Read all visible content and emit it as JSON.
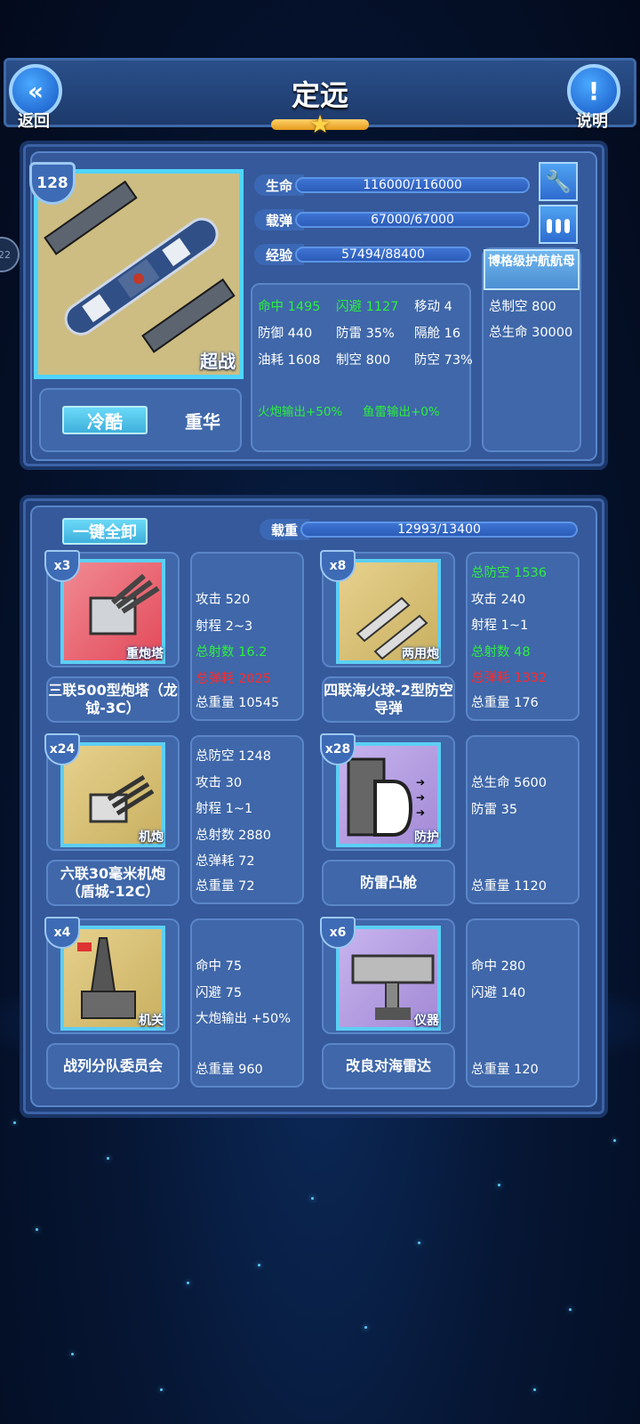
{
  "header": {
    "title": "定远",
    "back_label": "返回",
    "help_label": "说明"
  },
  "ship": {
    "level": "128",
    "class_tag": "超战",
    "trait_button": "冷酷",
    "trait_value": "重华",
    "bars": [
      {
        "label": "生命",
        "value": "116000/116000"
      },
      {
        "label": "载弹",
        "value": "67000/67000"
      },
      {
        "label": "经验",
        "value": "57494/88400"
      }
    ],
    "stats": [
      {
        "text": "命中 1495",
        "color": "green"
      },
      {
        "text": "闪避 1127",
        "color": "green"
      },
      {
        "text": "移动 4",
        "color": "white"
      },
      {
        "text": "防御 440",
        "color": "white"
      },
      {
        "text": "防雷 35%",
        "color": "white"
      },
      {
        "text": "隔舱 16",
        "color": "white"
      },
      {
        "text": "油耗 1608",
        "color": "white"
      },
      {
        "text": "制空 800",
        "color": "white"
      },
      {
        "text": "防空 73%",
        "color": "white"
      },
      {
        "text": "火炮输出+50%",
        "color": "green"
      },
      {
        "text": "鱼雷输出+0%",
        "color": "green"
      }
    ],
    "escort": {
      "button": "博格级护航航母",
      "lines": [
        "总制空 800",
        "总生命 30000"
      ]
    }
  },
  "equipment": {
    "unload_all": "一键全卸",
    "load_label": "载重",
    "load_value": "12993/13400",
    "items": [
      {
        "count": "x3",
        "tag": "重炮塔",
        "name": "三联500型炮塔（龙钺-3C）",
        "stats": [
          {
            "t": "攻击 520",
            "c": "white"
          },
          {
            "t": "射程 2~3",
            "c": "white"
          },
          {
            "t": "总射数 16.2",
            "c": "green"
          },
          {
            "t": "总弹耗 2025",
            "c": "red"
          },
          {
            "t": "总重量 10545",
            "c": "white"
          }
        ]
      },
      {
        "count": "x8",
        "tag": "两用炮",
        "name": "四联海火球-2型防空导弹",
        "stats": [
          {
            "t": "总防空 1536",
            "c": "green"
          },
          {
            "t": "攻击 240",
            "c": "white"
          },
          {
            "t": "射程 1~1",
            "c": "white"
          },
          {
            "t": "总射数 48",
            "c": "green"
          },
          {
            "t": "总弹耗 1332",
            "c": "red"
          },
          {
            "t": "总重量 176",
            "c": "white"
          }
        ]
      },
      {
        "count": "x24",
        "tag": "机炮",
        "name": "六联30毫米机炮（盾城-12C）",
        "stats": [
          {
            "t": "总防空 1248",
            "c": "white"
          },
          {
            "t": "攻击 30",
            "c": "white"
          },
          {
            "t": "射程 1~1",
            "c": "white"
          },
          {
            "t": "总射数 2880",
            "c": "white"
          },
          {
            "t": "总弹耗 72",
            "c": "white"
          },
          {
            "t": "总重量 72",
            "c": "white"
          }
        ]
      },
      {
        "count": "x28",
        "tag": "防护",
        "name": "防雷凸舱",
        "stats": [
          {
            "t": "总生命 5600",
            "c": "white"
          },
          {
            "t": "防雷 35",
            "c": "white"
          },
          {
            "t": "总重量 1120",
            "c": "white"
          }
        ]
      },
      {
        "count": "x4",
        "tag": "机关",
        "name": "战列分队委员会",
        "stats": [
          {
            "t": "命中 75",
            "c": "white"
          },
          {
            "t": "闪避 75",
            "c": "white"
          },
          {
            "t": "大炮输出 +50%",
            "c": "white"
          },
          {
            "t": "总重量 960",
            "c": "white"
          }
        ]
      },
      {
        "count": "x6",
        "tag": "仪器",
        "name": "改良对海雷达",
        "stats": [
          {
            "t": "命中 280",
            "c": "white"
          },
          {
            "t": "闪避 140",
            "c": "white"
          },
          {
            "t": "总重量 120",
            "c": "white"
          }
        ]
      }
    ]
  },
  "side_badge": "22"
}
